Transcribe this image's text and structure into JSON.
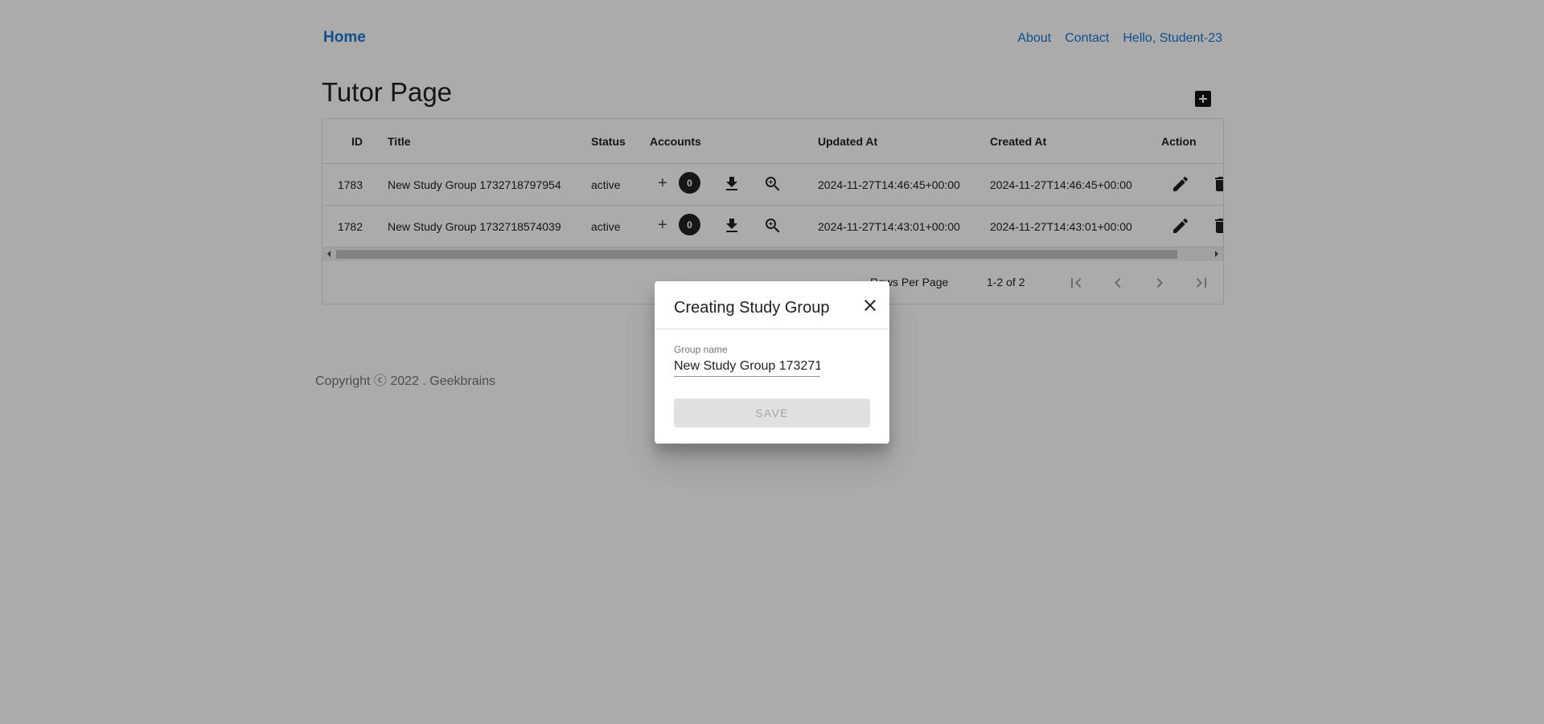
{
  "header": {
    "brand": "Home",
    "nav": [
      "About",
      "Contact",
      "Hello, Student-23"
    ]
  },
  "page": {
    "title": "Tutor Page"
  },
  "table": {
    "columns": [
      "ID",
      "Title",
      "Status",
      "Accounts",
      "Updated At",
      "Created At",
      "Action"
    ],
    "rows": [
      {
        "id": "1783",
        "title": "New Study Group 1732718797954",
        "status": "active",
        "accounts_add": "+",
        "accounts_count": "0",
        "updated_at": "2024-11-27T14:46:45+00:00",
        "created_at": "2024-11-27T14:46:45+00:00"
      },
      {
        "id": "1782",
        "title": "New Study Group 1732718574039",
        "status": "active",
        "accounts_add": "+",
        "accounts_count": "0",
        "updated_at": "2024-11-27T14:43:01+00:00",
        "created_at": "2024-11-27T14:43:01+00:00"
      }
    ]
  },
  "pagination": {
    "rows_per_page_label": "Rows Per Page",
    "range": "1-2 of 2"
  },
  "footer": {
    "text": "Copyright ⓒ 2022 . Geekbrains"
  },
  "dialog": {
    "title": "Creating Study Group",
    "field_label": "Group name",
    "field_value": "New Study Group 173271",
    "save_label": "SAVE"
  }
}
